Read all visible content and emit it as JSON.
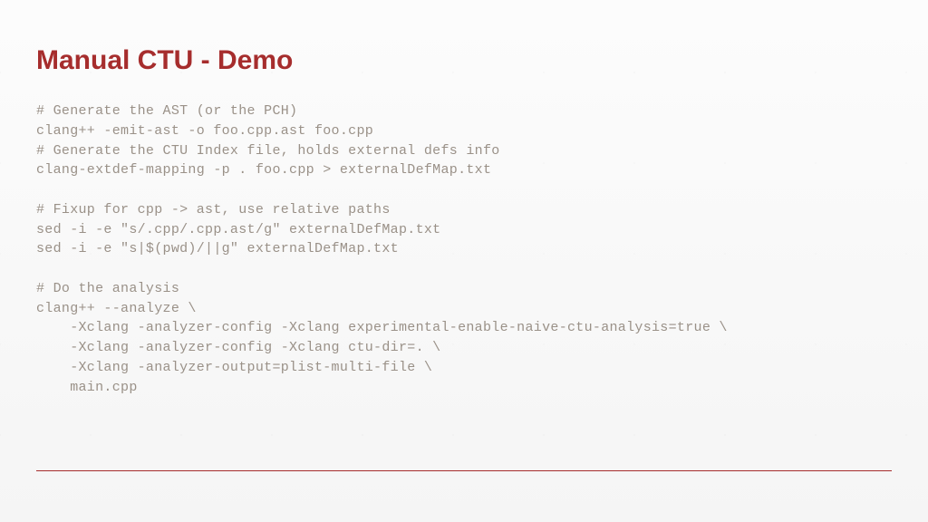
{
  "slide": {
    "title": "Manual CTU - Demo",
    "code": "# Generate the AST (or the PCH)\nclang++ -emit-ast -o foo.cpp.ast foo.cpp\n# Generate the CTU Index file, holds external defs info\nclang-extdef-mapping -p . foo.cpp > externalDefMap.txt\n\n# Fixup for cpp -> ast, use relative paths\nsed -i -e \"s/.cpp/.cpp.ast/g\" externalDefMap.txt\nsed -i -e \"s|$(pwd)/||g\" externalDefMap.txt\n\n# Do the analysis\nclang++ --analyze \\\n    -Xclang -analyzer-config -Xclang experimental-enable-naive-ctu-analysis=true \\\n    -Xclang -analyzer-config -Xclang ctu-dir=. \\\n    -Xclang -analyzer-output=plist-multi-file \\\n    main.cpp"
  }
}
